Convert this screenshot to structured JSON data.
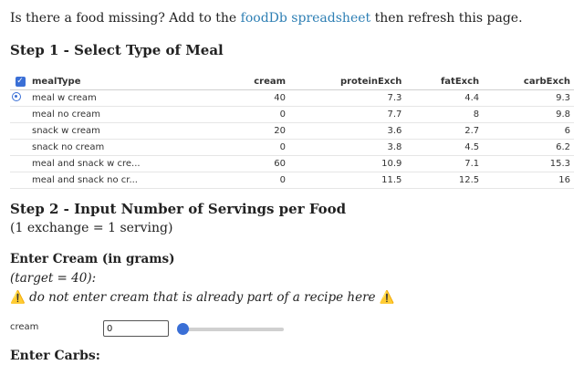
{
  "intro": {
    "prefix": "Is there a food missing? Add to the ",
    "link": "foodDb spreadsheet",
    "suffix": " then refresh this page."
  },
  "step1": {
    "title": "Step 1 - Select Type of Meal",
    "columns": [
      "mealType",
      "cream",
      "proteinExch",
      "fatExch",
      "carbExch"
    ],
    "rows": [
      {
        "mealType": "meal w cream",
        "cream": "40",
        "proteinExch": "7.3",
        "fatExch": "4.4",
        "carbExch": "9.3",
        "selected": true
      },
      {
        "mealType": "meal no cream",
        "cream": "0",
        "proteinExch": "7.7",
        "fatExch": "8",
        "carbExch": "9.8",
        "selected": false
      },
      {
        "mealType": "snack w cream",
        "cream": "20",
        "proteinExch": "3.6",
        "fatExch": "2.7",
        "carbExch": "6",
        "selected": false
      },
      {
        "mealType": "snack no cream",
        "cream": "0",
        "proteinExch": "3.8",
        "fatExch": "4.5",
        "carbExch": "6.2",
        "selected": false
      },
      {
        "mealType": "meal and snack w cre...",
        "cream": "60",
        "proteinExch": "10.9",
        "fatExch": "7.1",
        "carbExch": "15.3",
        "selected": false
      },
      {
        "mealType": "meal and snack no cr...",
        "cream": "0",
        "proteinExch": "11.5",
        "fatExch": "12.5",
        "carbExch": "16",
        "selected": false
      }
    ]
  },
  "step2": {
    "title": "Step 2 - Input Number of Servings per Food",
    "subtitle": "(1 exchange = 1 serving)"
  },
  "cream": {
    "heading": "Enter Cream (in grams)",
    "target": "(target = 40)",
    "warning_icon": "⚠️",
    "warning": " do not enter cream that is already part of a recipe here ",
    "label": "cream",
    "value": "0",
    "slider_fraction": 0
  },
  "carbs": {
    "heading": "Enter Carbs:"
  },
  "colors": {
    "link": "#2e7fb4",
    "accent": "#3a6fd6"
  }
}
